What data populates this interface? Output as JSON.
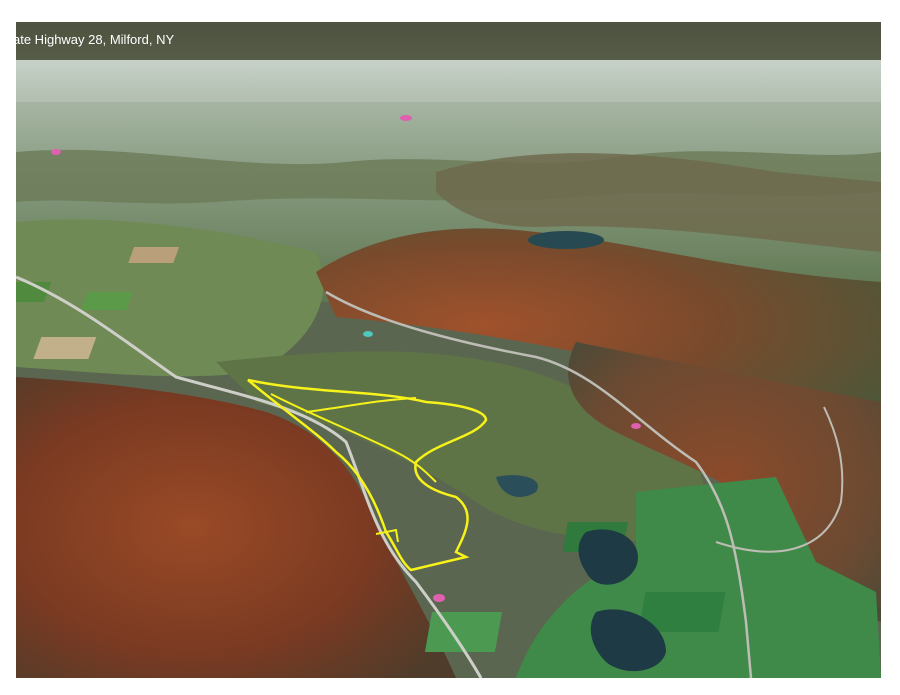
{
  "map": {
    "title": "ate Highway 28, Milford, NY",
    "view": "oblique satellite 3D terrain",
    "season": "autumn foliage",
    "parcel_outline_color": "#f6f21a",
    "marker_color": "#e060b0",
    "road_color": "#cfcfc9"
  }
}
